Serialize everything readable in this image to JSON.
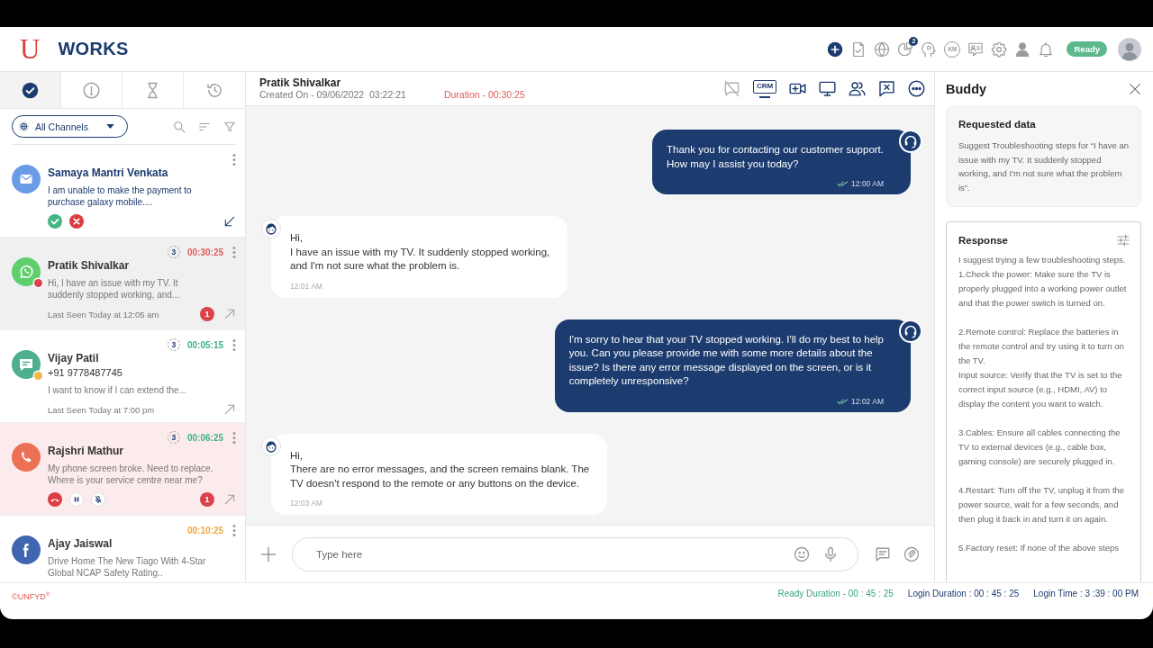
{
  "header": {
    "logo_mark": "U",
    "logo_text": "WORKS",
    "actions": [
      {
        "kind": "add"
      },
      {
        "kind": "document"
      },
      {
        "kind": "globe"
      },
      {
        "kind": "pie",
        "badge": "2"
      },
      {
        "kind": "head"
      },
      {
        "kind": "km",
        "label": "KM"
      },
      {
        "kind": "contact"
      },
      {
        "kind": "settings"
      },
      {
        "kind": "person"
      },
      {
        "kind": "bell"
      }
    ],
    "status": "Ready"
  },
  "left_panel": {
    "tabs": [
      {
        "kind": "done",
        "selected": true
      },
      {
        "kind": "alert",
        "selected": false
      },
      {
        "kind": "waiting",
        "selected": false
      },
      {
        "kind": "history",
        "selected": false
      }
    ],
    "channel_filter": "All Channels"
  },
  "conversations": [
    {
      "kind": "email",
      "name": "Samaya Mantri Venkata",
      "preview": "I am unable to make the payment to purchase galaxy mobile....",
      "arrow": {
        "incoming": true
      },
      "pending": true,
      "selected": false
    },
    {
      "kind": "whatsapp",
      "name": "Pratik Shivalkar",
      "status_dot": {
        "color": "#d9434a"
      },
      "cycle_count": "3",
      "duration": {
        "text": "00:30:25",
        "color": "#e45b5b"
      },
      "preview": "Hi, I have an issue with my TV. It suddenly stopped working, and...",
      "last_seen": "Last Seen Today at 12:05 am",
      "unread": "1",
      "arrow": {
        "incoming": false
      },
      "pending": false,
      "selected": true
    },
    {
      "kind": "chat",
      "name": "Vijay Patil",
      "status_dot": {
        "color": "#f2b64a"
      },
      "cycle_count": "3",
      "duration": {
        "text": "00:05:15",
        "color": "#3fb28a"
      },
      "phone": "+91 9778487745",
      "preview": "I want to know if I can extend the...",
      "last_seen": "Last Seen Today at 7:00 pm",
      "arrow": {
        "incoming": false
      },
      "pending": false,
      "selected": false
    },
    {
      "kind": "call",
      "name": "Rajshri Mathur",
      "cycle_count": "3",
      "duration": {
        "text": "00:06:25",
        "color": "#3fb28a"
      },
      "preview": "My phone screen broke. Need to replace. Where is your service centre near me?",
      "unread": "1",
      "arrow": {
        "incoming": false
      },
      "pending": false,
      "selected": false
    },
    {
      "kind": "facebook",
      "name": "Ajay Jaiswal",
      "duration": {
        "text": "00:10:25",
        "color": "#f0a73a"
      },
      "preview": "Drive Home The New Tiago With 4-Star Global NCAP Safety Rating..",
      "pending": false,
      "selected": false
    }
  ],
  "chat": {
    "contact": "Pratik Shivalkar",
    "created": "Created On - 09/06/2022  03:22:21",
    "duration": "Duration - 00:30:25",
    "toolbar": [
      {
        "kind": "chat-off",
        "disabled": true
      },
      {
        "kind": "crm",
        "label": "CRM",
        "disabled": false
      },
      {
        "kind": "video",
        "disabled": false
      },
      {
        "kind": "screen",
        "disabled": false
      },
      {
        "kind": "people",
        "disabled": false
      },
      {
        "kind": "close-chat",
        "disabled": false
      },
      {
        "kind": "more",
        "disabled": false
      }
    ],
    "messages": [
      {
        "kind": "agent",
        "text": "Thank you for contacting our customer support.\nHow may I assist you today?",
        "time": "12:00 AM",
        "delivered": true
      },
      {
        "kind": "customer",
        "text": "Hi,\nI have an issue with my TV. It suddenly stopped working,\nand I'm not sure what the problem is.",
        "time": "12:01 AM",
        "delivered": false
      },
      {
        "kind": "agent",
        "text": "I'm sorry to hear that your TV stopped working. I'll do my best to help\nyou. Can you please provide me with some more details about the\nissue? Is there any error message displayed on the screen, or is it\ncompletely unresponsive?",
        "time": "12:02 AM",
        "delivered": true
      },
      {
        "kind": "customer",
        "text": "Hi,\nThere are no error messages, and the screen remains blank. The\nTV doesn't respond to the remote or any buttons on the device.",
        "time": "12:03 AM",
        "delivered": false
      }
    ],
    "composer": {
      "placeholder": "Type here"
    }
  },
  "buddy": {
    "title": "Buddy",
    "request": {
      "title": "Requested data",
      "text": "Suggest Troubleshooting steps for “I have an issue with my TV. It suddenly stopped working, and I'm not sure what the problem is”."
    },
    "response": {
      "title": "Response",
      "text": "I suggest trying a few troubleshooting steps.\n1.Check the power: Make sure the TV is properly plugged into a working power outlet and that the power switch is turned on.\n\n2.Remote control: Replace the batteries in the remote control and try using it to turn on the TV.\nInput source: Verify that the TV is set to the correct input source (e.g., HDMI, AV) to display the content you want to watch.\n\n3.Cables: Ensure all cables connecting the TV to external devices (e.g., cable box, gaming console) are securely plugged in.\n\n4.Restart: Turn off the TV, unplug it from the power source, wait for a few seconds, and then plug it back in and turn it on again.\n\n5.Factory reset: If none of the above steps"
    }
  },
  "footer": {
    "copyright": "©UNFYD$^{®}$",
    "ready_duration": "Ready Duration - 00 : 45 : 25",
    "login_duration": "Login Duration : 00 : 45 : 25",
    "login_time": "Login Time : 3 :39 : 00 PM"
  }
}
